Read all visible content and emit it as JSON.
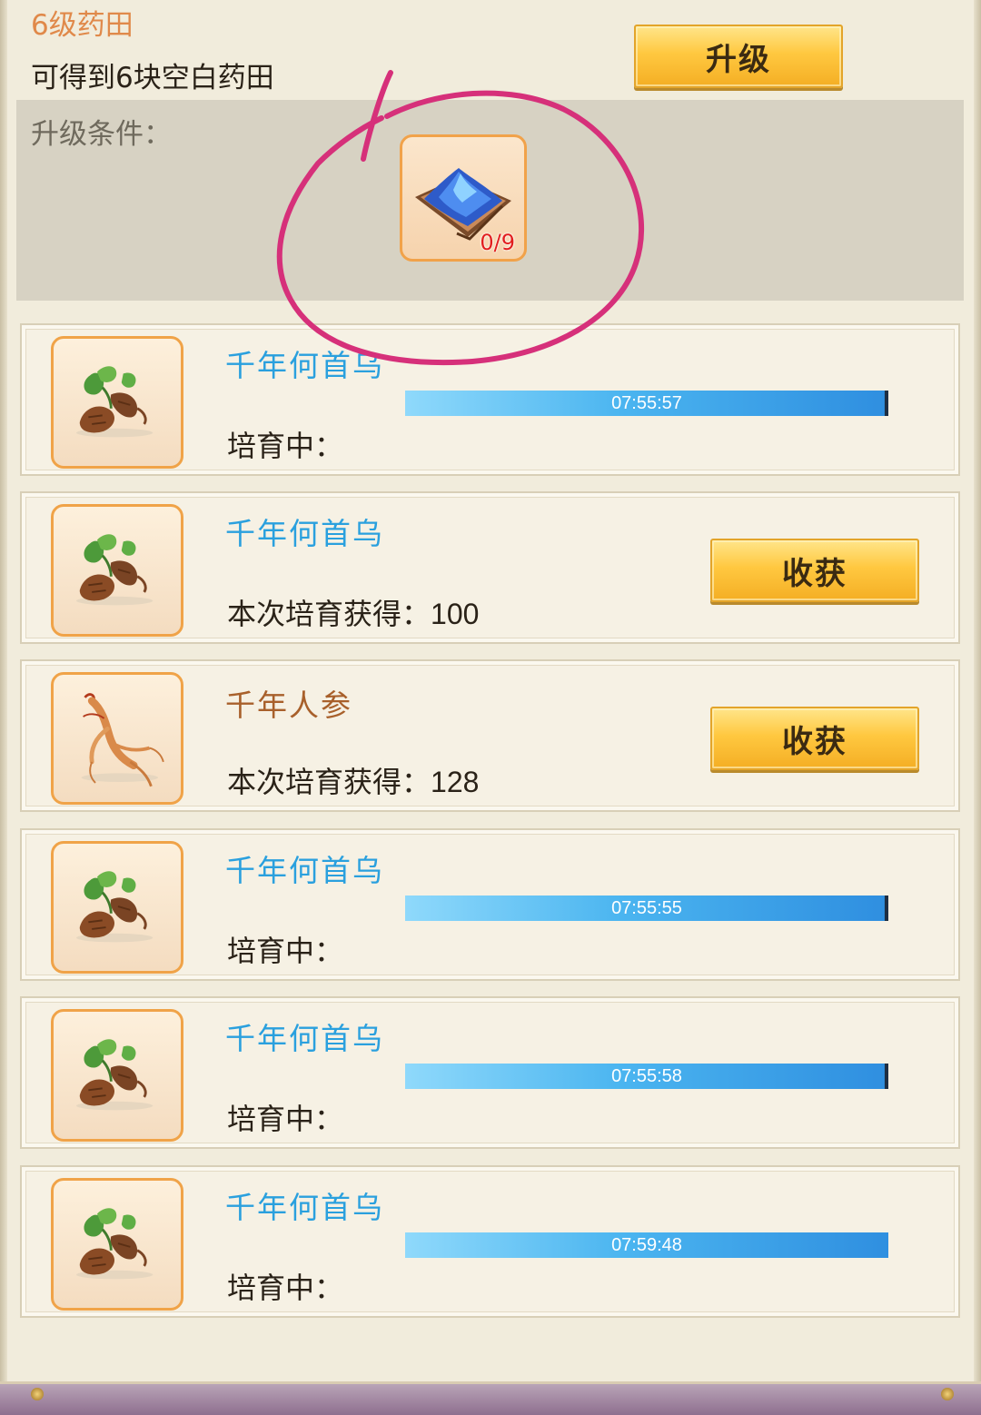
{
  "header": {
    "title": "6级药田",
    "description": "可得到6块空白药田",
    "upgrade_button": "升级"
  },
  "upgrade_condition": {
    "label": "升级条件：",
    "item_icon": "blue-powder-item-icon",
    "item_count": "0/9"
  },
  "rows": [
    {
      "name": "千年何首乌",
      "icon": "heshouwu-herb-icon",
      "status": "培育中：",
      "timer": "07:55:57",
      "progress": 0.99
    },
    {
      "name": "千年何首乌",
      "icon": "heshouwu-herb-icon",
      "status": "本次培育获得：",
      "yield": "100",
      "button": "收获"
    },
    {
      "name": "千年人参",
      "icon": "ginseng-herb-icon",
      "status": "本次培育获得：",
      "yield": "128",
      "button": "收获"
    },
    {
      "name": "千年何首乌",
      "icon": "heshouwu-herb-icon",
      "status": "培育中：",
      "timer": "07:55:55",
      "progress": 0.99
    },
    {
      "name": "千年何首乌",
      "icon": "heshouwu-herb-icon",
      "status": "培育中：",
      "timer": "07:55:58",
      "progress": 0.99
    },
    {
      "name": "千年何首乌",
      "icon": "heshouwu-herb-icon",
      "status": "培育中：",
      "timer": "07:59:48",
      "progress": 1.0
    }
  ],
  "colors": {
    "title": "#e0894a",
    "herb_name_blue": "#2aa0de",
    "herb_name_brown": "#a8602b",
    "annotation": "#d6307a"
  }
}
